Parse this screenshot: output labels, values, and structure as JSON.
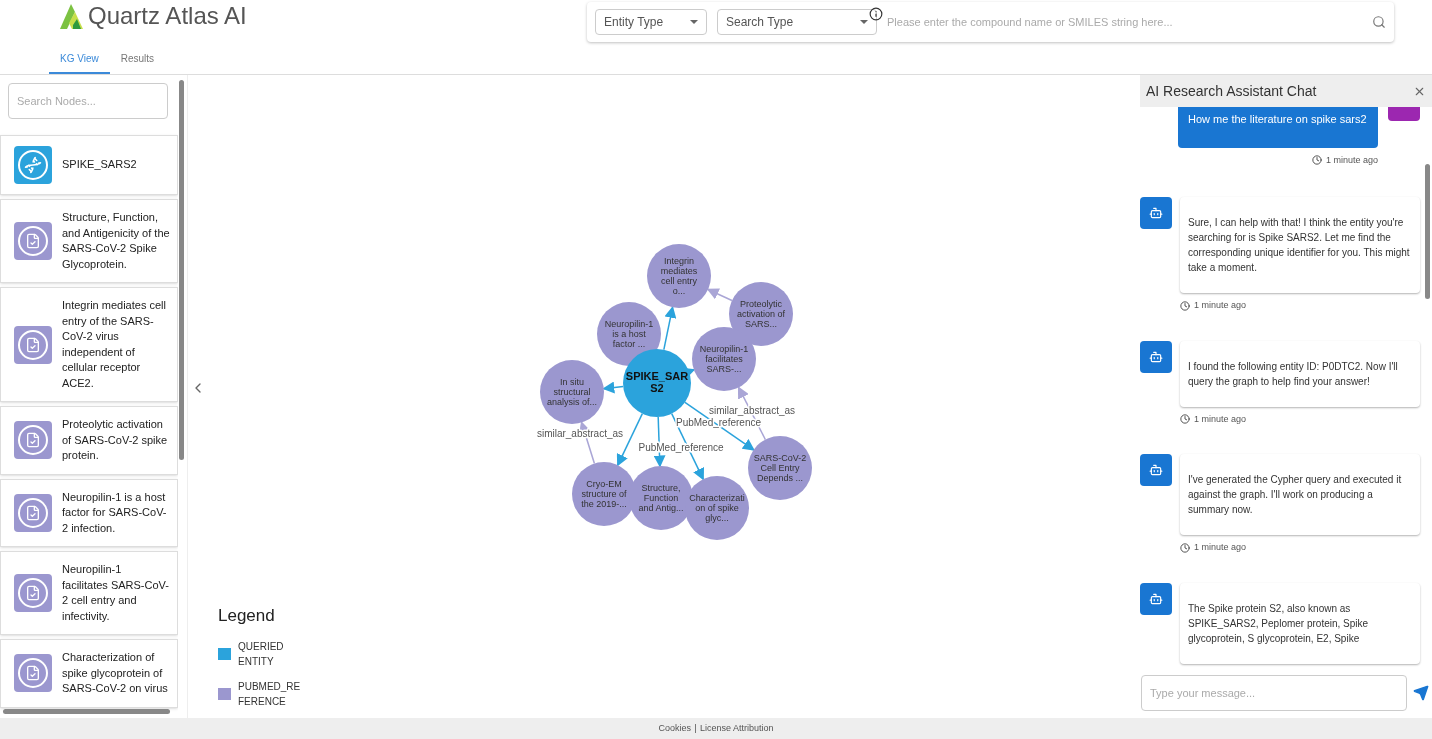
{
  "header": {
    "brand": "Quartz Atlas AI",
    "entity_type": {
      "placeholder": "Entity Type"
    },
    "search_type": {
      "placeholder": "Search Type"
    },
    "search": {
      "placeholder": "Please enter the compound name or SMILES string here..."
    }
  },
  "tabs": [
    {
      "label": "KG View",
      "selected": true
    },
    {
      "label": "Results",
      "selected": false
    }
  ],
  "sidebar": {
    "search": {
      "placeholder": "Search Nodes..."
    },
    "items": [
      {
        "kind": "entity",
        "label": "SPIKE_SARS2"
      },
      {
        "kind": "paper",
        "label": "Structure, Function, and Antigenicity of the SARS-CoV-2 Spike Glycoprotein."
      },
      {
        "kind": "paper",
        "label": "Integrin mediates cell entry of the SARS-CoV-2 virus independent of cellular receptor ACE2."
      },
      {
        "kind": "paper",
        "label": "Proteolytic activation of SARS-CoV-2 spike protein."
      },
      {
        "kind": "paper",
        "label": "Neuropilin-1 is a host factor for SARS-CoV-2 infection."
      },
      {
        "kind": "paper",
        "label": "Neuropilin-1 facilitates SARS-CoV-2 cell entry and infectivity."
      },
      {
        "kind": "paper",
        "label": "Characterization of spike glycoprotein of SARS-CoV-2 on virus"
      }
    ]
  },
  "graph": {
    "nodes": [
      {
        "kind": "paper",
        "lines": [
          "Integrin",
          "mediates",
          "cell entry",
          "o..."
        ]
      },
      {
        "kind": "paper",
        "lines": [
          "Proteolytic",
          "activation of",
          "SARS..."
        ]
      },
      {
        "kind": "paper",
        "lines": [
          "Neuropilin-1",
          "is a host",
          "factor ..."
        ]
      },
      {
        "kind": "paper",
        "lines": [
          "Neuropilin-1",
          "facilitates",
          "SARS-..."
        ]
      },
      {
        "kind": "paper",
        "lines": [
          "In situ",
          "structural",
          "analysis of..."
        ]
      },
      {
        "kind": "paper",
        "lines": [
          "Cryo-EM",
          "structure of",
          "the 2019-..."
        ]
      },
      {
        "kind": "paper",
        "lines": [
          "Structure,",
          "Function",
          "and Antig..."
        ]
      },
      {
        "kind": "paper",
        "lines": [
          "Characterizati",
          "on of spike",
          "glyc..."
        ]
      },
      {
        "kind": "paper",
        "lines": [
          "SARS-CoV-2",
          "Cell Entry",
          "Depends ..."
        ]
      },
      {
        "kind": "entity",
        "lines": [
          "SPIKE_SAR",
          "S2"
        ]
      }
    ],
    "edges": [
      {
        "kind": "reference"
      },
      {
        "kind": "reference"
      },
      {
        "kind": "reference"
      },
      {
        "kind": "reference"
      },
      {
        "kind": "reference"
      },
      {
        "kind": "reference",
        "label": "PubMed_reference"
      },
      {
        "kind": "reference"
      },
      {
        "kind": "reference",
        "label": "PubMed_reference"
      },
      {
        "kind": "similar"
      },
      {
        "kind": "similar"
      },
      {
        "kind": "similar",
        "label": "similar_abstract_as"
      },
      {
        "kind": "similar",
        "label": "similar_abstract_as"
      }
    ]
  },
  "legend": {
    "title": "Legend",
    "items": [
      {
        "label": "QUERIED ENTITY",
        "color": "#2ba3dc"
      },
      {
        "label": "PUBMED_REFERENCE",
        "color": "#9b97cf"
      }
    ]
  },
  "chat": {
    "title": "AI Research Assistant Chat",
    "messages": [
      {
        "kind": "user",
        "text": "How me the literature on spike sars2",
        "time": "1 minute ago"
      },
      {
        "kind": "bot",
        "text": "Sure, I can help with that! I think the entity you're searching for is Spike SARS2. Let me find the corresponding unique identifier for you. This might take a moment.",
        "time": "1 minute ago"
      },
      {
        "kind": "bot",
        "text": "I found the following entity ID: P0DTC2. Now I'll query the graph to help find your answer!",
        "time": "1 minute ago"
      },
      {
        "kind": "bot",
        "text": "I've generated the Cypher query and executed it against the graph. I'll work on producing a summary now.",
        "time": "1 minute ago"
      },
      {
        "kind": "bot",
        "text": "The Spike protein S2, also known as SPIKE_SARS2, Peplomer protein, Spike glycoprotein, S glycoprotein, E2, Spike"
      }
    ],
    "input": {
      "placeholder": "Type your message..."
    }
  },
  "footer": [
    "Cookies",
    "License Attribution"
  ]
}
